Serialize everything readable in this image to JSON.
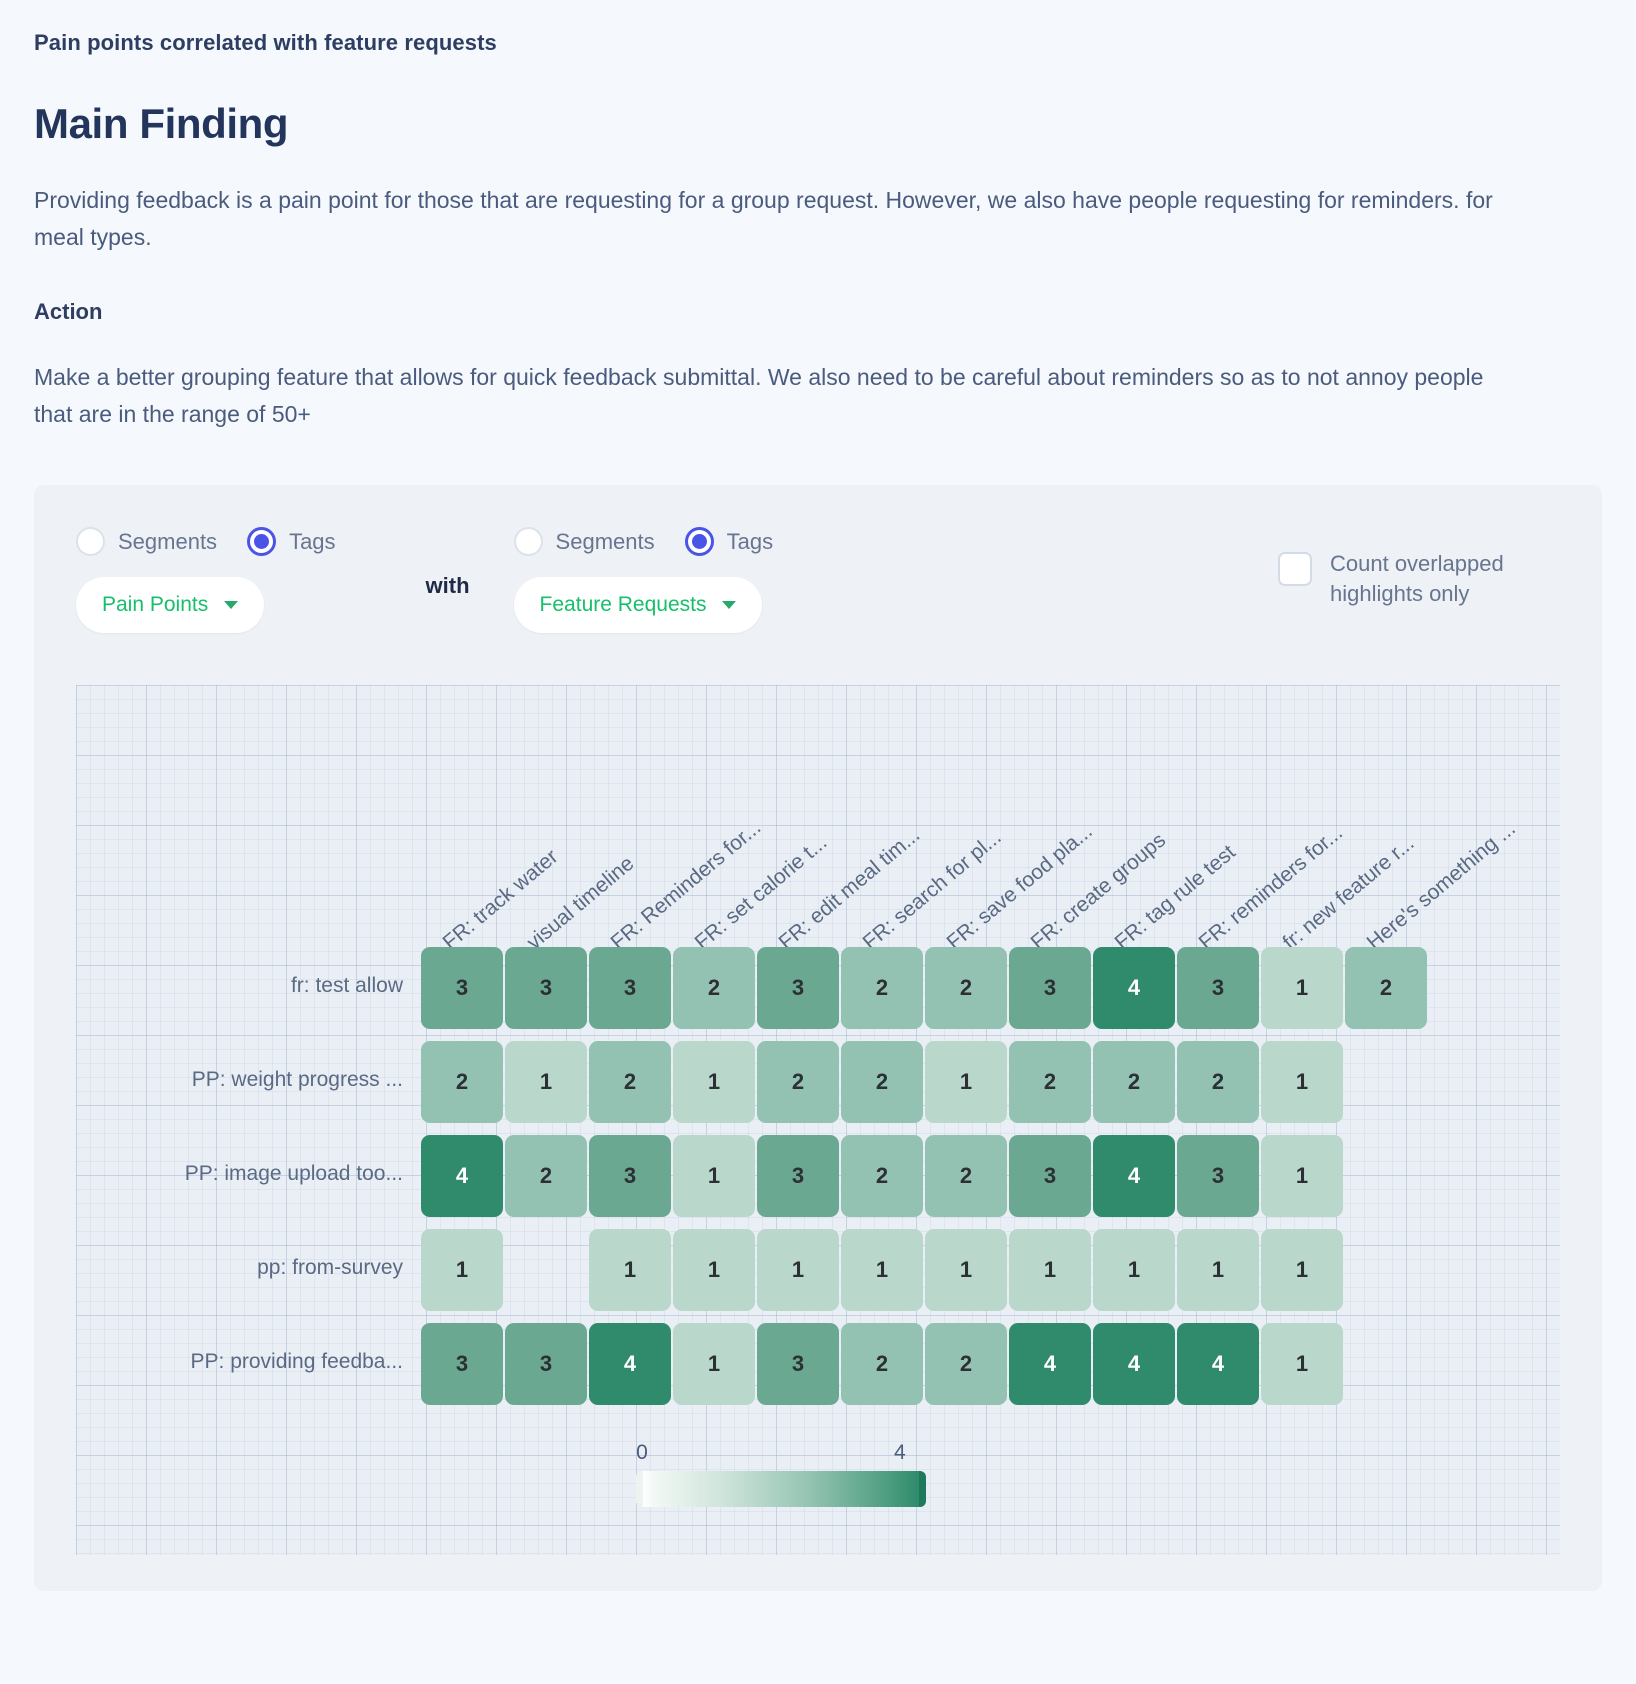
{
  "header": {
    "kicker": "Pain points correlated with feature requests",
    "title": "Main Finding",
    "finding": "Providing feedback is a pain point for those that are requesting for a group request. However, we also have people requesting for reminders. for meal types.",
    "action_label": "Action",
    "action_text": "Make a better grouping feature that allows for quick feedback submittal. We also need to be careful about reminders so as to not annoy people that are in the range of 50+"
  },
  "controls": {
    "left": {
      "option_segments": "Segments",
      "option_tags": "Tags",
      "selected": "Tags",
      "dropdown_value": "Pain Points"
    },
    "conjunction": "with",
    "right": {
      "option_segments": "Segments",
      "option_tags": "Tags",
      "selected": "Tags",
      "dropdown_value": "Feature Requests"
    },
    "checkbox": {
      "label": "Count overlapped highlights only",
      "checked": false
    }
  },
  "colors": {
    "accent_green": "#16c06a",
    "radio_blue": "#4a55e8",
    "panel_bg": "#eef2f7",
    "page_bg": "#f5f8fc",
    "scale_min": "#ffffff",
    "scale_max": "#2f8b6b"
  },
  "chart_data": {
    "type": "heatmap",
    "title": "Pain points correlated with feature requests",
    "xlabel": "Feature Requests",
    "ylabel": "Pain Points",
    "columns": [
      "FR: track water",
      "visual timeline",
      "FR: Reminders for...",
      "FR: set calorie t...",
      "FR: edit meal tim...",
      "FR: search for pl...",
      "FR: save food pla...",
      "FR: create groups",
      "FR: tag rule test",
      "FR: reminders for...",
      "fr: new feature r...",
      "Here's something ..."
    ],
    "rows": [
      "fr: test allow",
      "PP: weight progress ...",
      "PP: image upload too...",
      "pp: from-survey",
      "PP: providing feedba..."
    ],
    "values": [
      [
        3,
        3,
        3,
        2,
        3,
        2,
        2,
        3,
        4,
        3,
        1,
        2
      ],
      [
        2,
        1,
        2,
        1,
        2,
        2,
        1,
        2,
        2,
        2,
        1,
        null
      ],
      [
        4,
        2,
        3,
        1,
        3,
        2,
        2,
        3,
        4,
        3,
        1,
        null
      ],
      [
        1,
        null,
        1,
        1,
        1,
        1,
        1,
        1,
        1,
        1,
        1,
        null
      ],
      [
        3,
        3,
        4,
        1,
        3,
        2,
        2,
        4,
        4,
        4,
        1,
        null
      ]
    ],
    "colorbar": {
      "min": 0,
      "max": 4,
      "min_label": "0",
      "max_label": "4"
    },
    "grid": true,
    "legend_position": "bottom"
  }
}
